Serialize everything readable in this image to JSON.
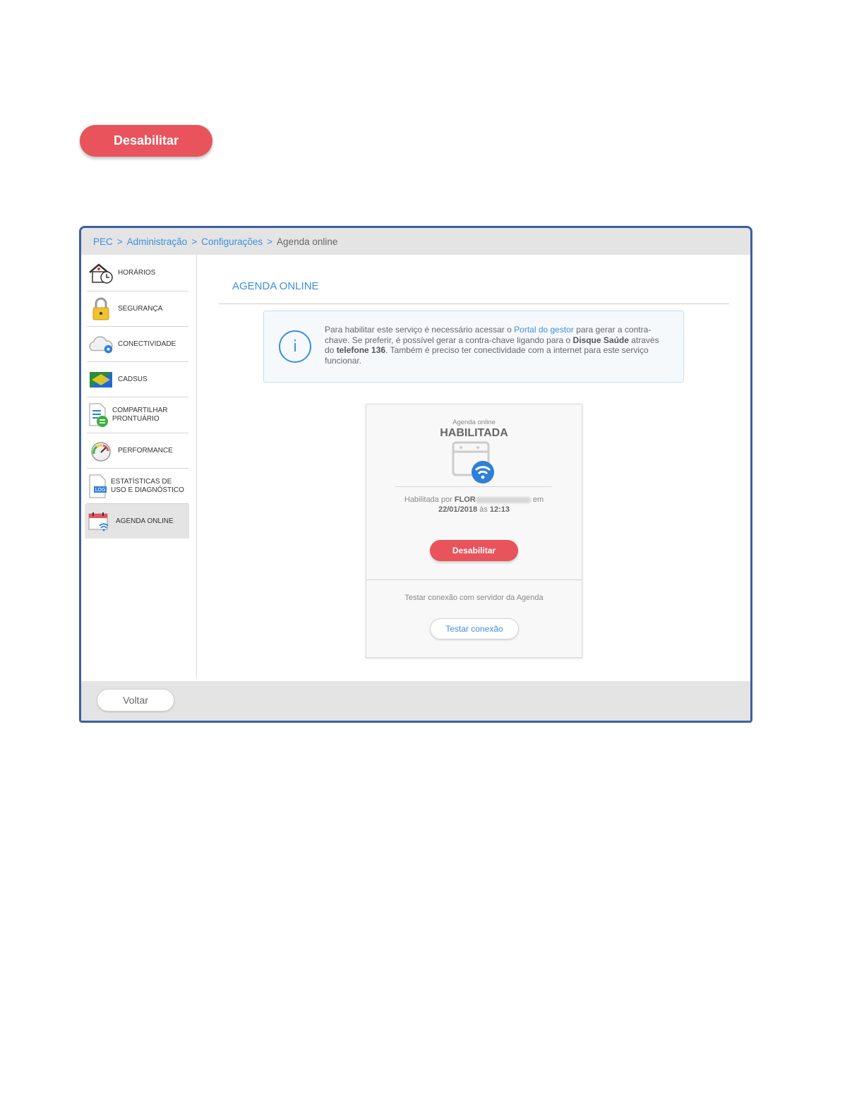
{
  "top_button": {
    "label": "Desabilitar"
  },
  "breadcrumb": {
    "items": [
      "PEC",
      "Administração",
      "Configurações"
    ],
    "separator": ">",
    "current": "Agenda online"
  },
  "sidebar": {
    "items": [
      {
        "label": "HORÁRIOS",
        "icon": "house-clock-icon"
      },
      {
        "label": "SEGURANÇA",
        "icon": "padlock-icon"
      },
      {
        "label": "CONECTIVIDADE",
        "icon": "cloud-gear-icon"
      },
      {
        "label": "CADSUS",
        "icon": "cadsus-card-icon"
      },
      {
        "label": "COMPARTILHAR PRONTUÁRIO",
        "icon": "document-share-icon"
      },
      {
        "label": "PERFORMANCE",
        "icon": "gauge-icon"
      },
      {
        "label": "ESTATÍSTICAS DE USO E DIAGNÓSTICO",
        "icon": "log-file-icon"
      },
      {
        "label": "AGENDA ONLINE",
        "icon": "calendar-wifi-icon",
        "active": true
      }
    ]
  },
  "main": {
    "title": "AGENDA ONLINE",
    "info": {
      "icon": "info-icon",
      "text_1": "Para habilitar este serviço é necessário acessar o ",
      "link": "Portal do gestor",
      "text_2": " para gerar a contra-chave. Se preferir, é possível gerar a contra-chave ligando para o ",
      "bold_1": "Disque Saúde",
      "text_3": " através do ",
      "bold_2": "telefone 136",
      "text_4": ". Também é preciso ter conectividade com a internet para este serviço funcionar."
    },
    "status_card": {
      "small_label": "Agenda online",
      "status": "HABILITADA",
      "icon": "browser-wifi-icon",
      "enabled_by_prefix": "Habilitada por",
      "enabled_by_name": "FLOR",
      "enabled_by_em": "em",
      "date": "22/01/2018",
      "at": "às",
      "time": "12:13",
      "disable_label": "Desabilitar",
      "test_label": "Testar conexão com servidor da Agenda",
      "test_button": "Testar conexão"
    }
  },
  "footer": {
    "back_label": "Voltar"
  },
  "colors": {
    "accent": "#3d8fe0",
    "danger": "#e9535c",
    "border": "#3d5f9d"
  }
}
